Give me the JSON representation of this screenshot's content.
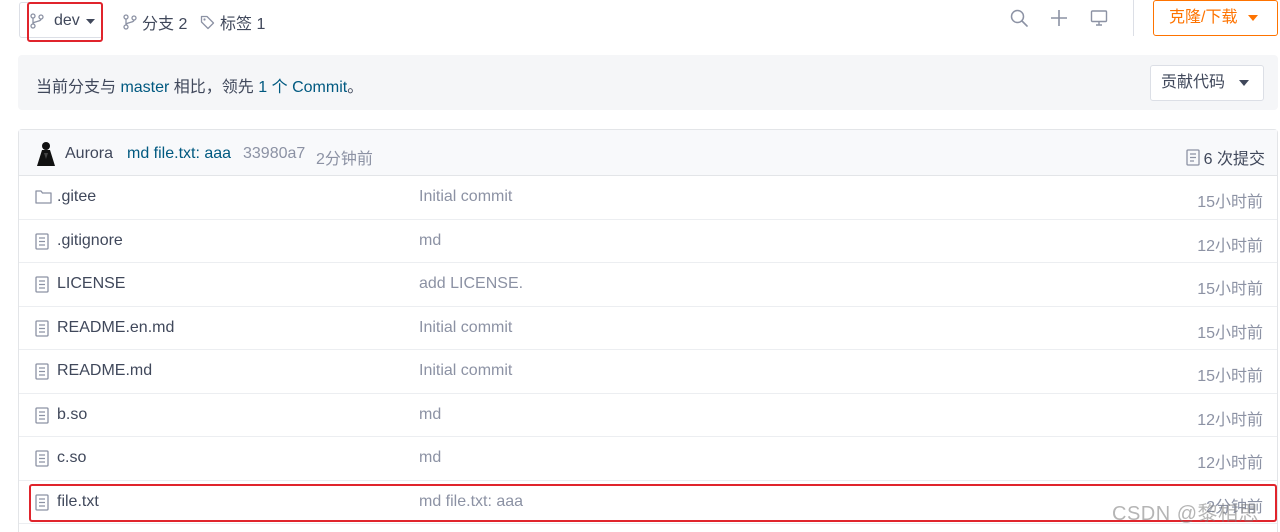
{
  "toolbar": {
    "branch": "dev",
    "branches_label": "分支 2",
    "tags_label": "标签 1",
    "clone_label": "克隆/下载"
  },
  "banner": {
    "prefix": "当前分支与 ",
    "base_branch": "master",
    "middle": " 相比，领先 ",
    "ahead_count": "1",
    "unit": " 个 ",
    "commit_word": "Commit",
    "suffix": "。",
    "contribute_label": "贡献代码"
  },
  "last_commit": {
    "author": "Aurora",
    "message": "md file.txt: aaa",
    "sha": "33980a7",
    "time": "2分钟前",
    "count_label": "6 次提交"
  },
  "files": [
    {
      "name": ".gitee",
      "type": "folder",
      "message": "Initial commit",
      "time": "15小时前"
    },
    {
      "name": ".gitignore",
      "type": "file",
      "message": "md",
      "time": "12小时前"
    },
    {
      "name": "LICENSE",
      "type": "file",
      "message": "add LICENSE.",
      "time": "15小时前"
    },
    {
      "name": "README.en.md",
      "type": "file",
      "message": "Initial commit",
      "time": "15小时前"
    },
    {
      "name": "README.md",
      "type": "file",
      "message": "Initial commit",
      "time": "15小时前"
    },
    {
      "name": "b.so",
      "type": "file",
      "message": "md",
      "time": "12小时前"
    },
    {
      "name": "c.so",
      "type": "file",
      "message": "md",
      "time": "12小时前"
    },
    {
      "name": "file.txt",
      "type": "file",
      "message": "md file.txt: aaa",
      "time": "2分钟前"
    }
  ],
  "watermark": "CSDN @黎相思",
  "colors": {
    "accent": "#fe7300",
    "link": "#005980",
    "highlight": "#e0242c"
  }
}
